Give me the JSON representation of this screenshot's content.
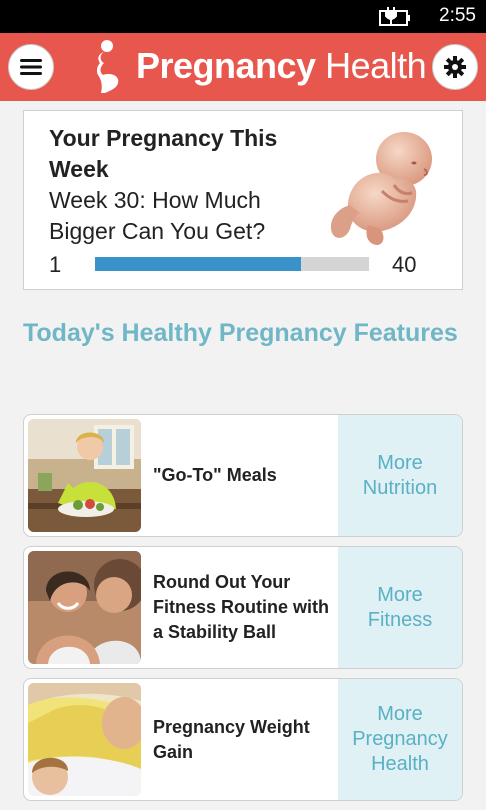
{
  "status_bar": {
    "time": "2:55",
    "icons": [
      "battery-charging-icon"
    ]
  },
  "header": {
    "brand_bold": "Pregnancy",
    "brand_light": "Health",
    "menu_icon": "hamburger-icon",
    "settings_icon": "gear-icon",
    "colors": {
      "header_bg": "#e8574d",
      "accent_teal": "#6fb6c6",
      "progress_blue": "#3a93c8"
    }
  },
  "week_card": {
    "title": "Your Pregnancy This Week",
    "subtitle": "Week 30: How Much Bigger Can You Get?",
    "progress": {
      "start_label": "1",
      "end_label": "40",
      "current_week": 30,
      "max_week": 40
    }
  },
  "features": {
    "heading": "Today's Healthy Pregnancy Features",
    "items": [
      {
        "title": "\"Go-To\" Meals",
        "more_label": "More Nutrition"
      },
      {
        "title": "Round Out Your Fitness Routine with a Stability Ball",
        "more_label": "More Fitness"
      },
      {
        "title": "Pregnancy Weight Gain",
        "more_label": "More Pregnancy Health"
      }
    ]
  }
}
